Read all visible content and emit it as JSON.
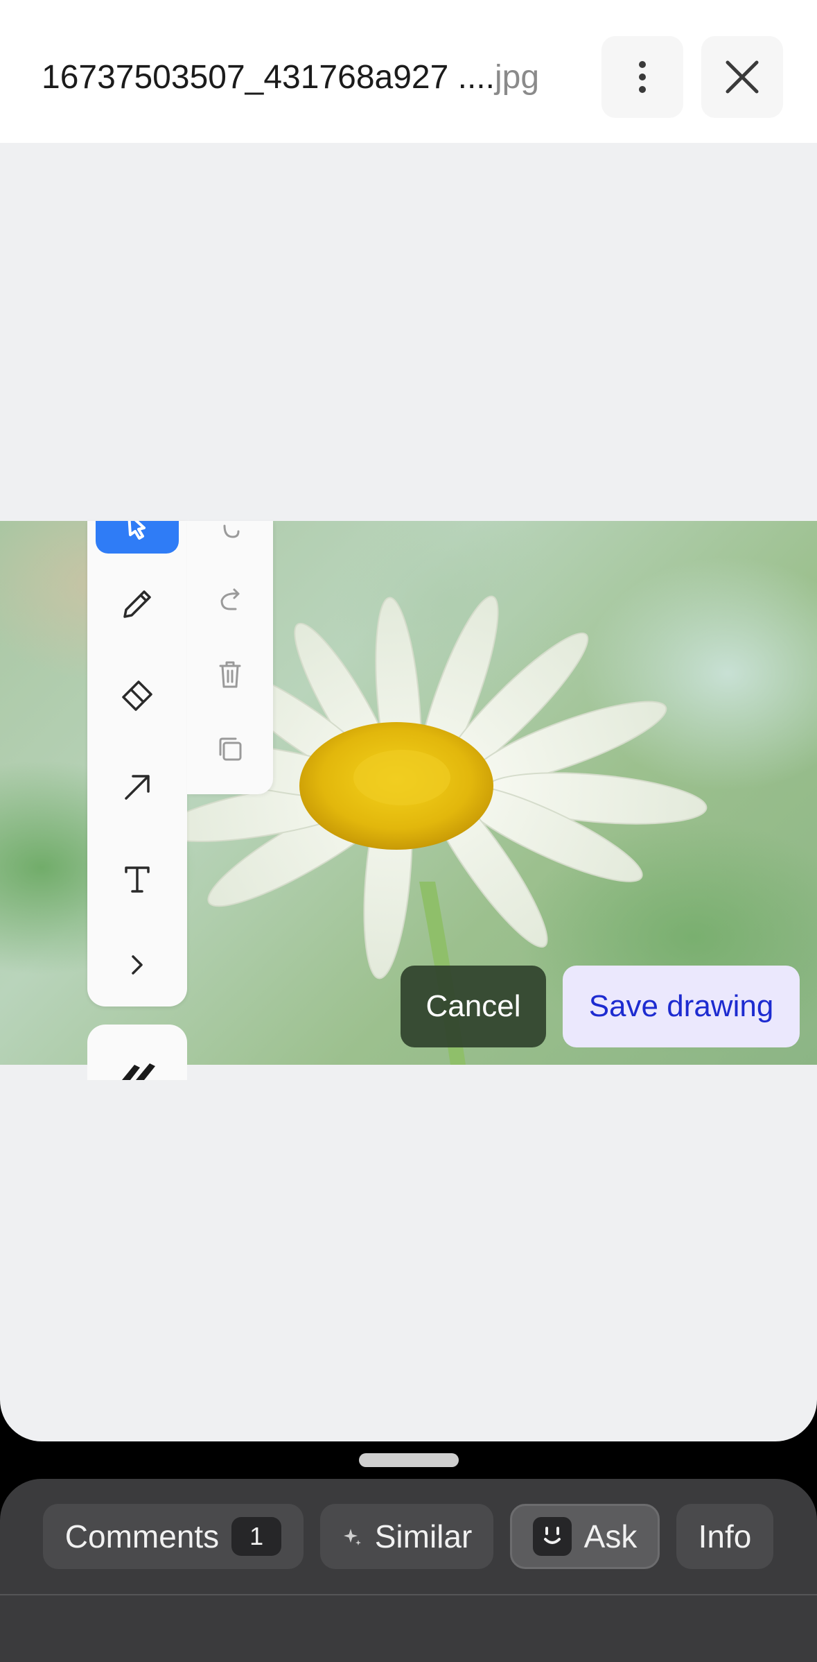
{
  "header": {
    "file_name": "16737503507_431768a927 ....",
    "file_ext": "jpg",
    "more_icon": "more-vertical-icon",
    "close_icon": "close-icon"
  },
  "toolbar": {
    "active_tool": "select",
    "tools": [
      "select-icon",
      "pencil-icon",
      "eraser-icon",
      "arrow-icon",
      "text-icon",
      "chevron-right-icon"
    ],
    "subtools": [
      "undo-icon",
      "redo-icon",
      "trash-icon",
      "copy-icon"
    ],
    "accent": "#2f7cf6"
  },
  "actions": {
    "cancel_label": "Cancel",
    "save_label": "Save drawing"
  },
  "bottom_bar": {
    "comments_label": "Comments",
    "comments_count": "1",
    "similar_label": "Similar",
    "ask_label": "Ask",
    "info_label": "Info"
  }
}
